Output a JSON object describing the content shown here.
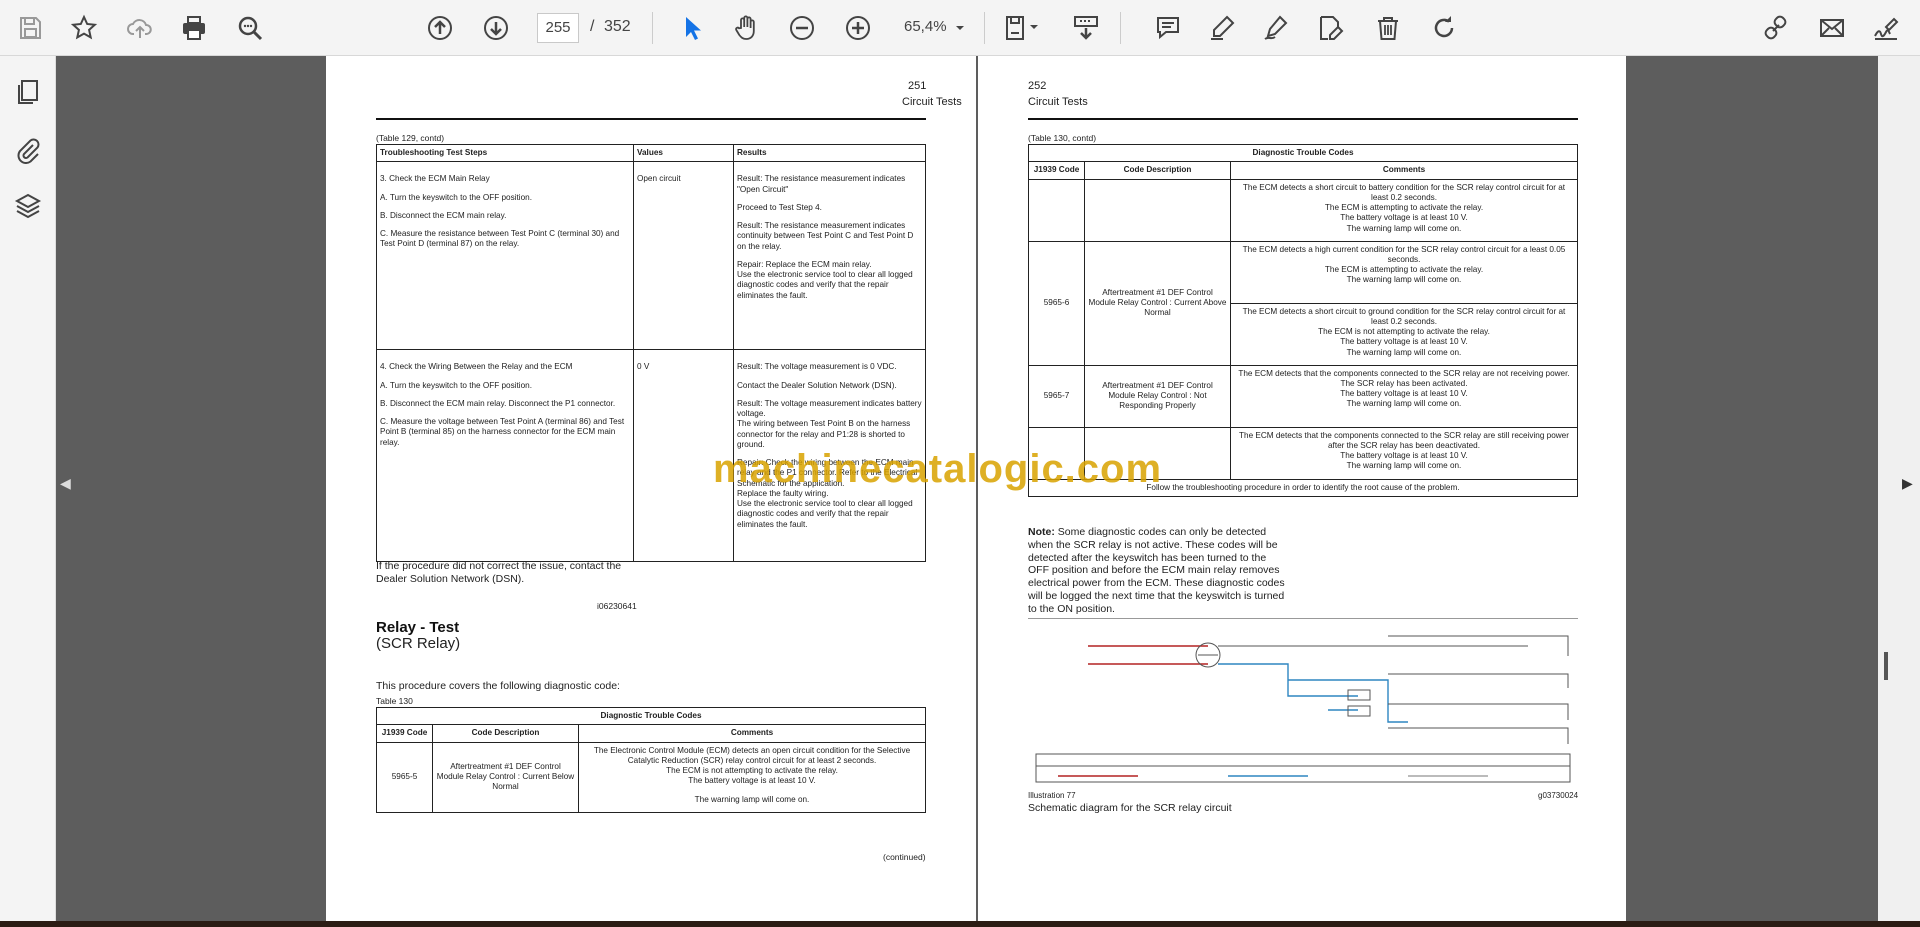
{
  "toolbar": {
    "page_current": "255",
    "page_separator": "/",
    "page_total": "352",
    "zoom": "65,4%"
  },
  "colors": {
    "accent": "#1473e6",
    "viewer_bg": "#5d5d5d",
    "watermark": "#d9a300"
  },
  "icons": [
    "save-icon",
    "star-icon",
    "cloud-upload-icon",
    "print-icon",
    "find-icon",
    "page-up-icon",
    "page-down-icon",
    "select-cursor-icon",
    "hand-icon",
    "zoom-out-icon",
    "zoom-in-icon",
    "chevron-down-icon",
    "fit-page-icon",
    "scroll-mode-icon",
    "comment-icon",
    "highlight-icon",
    "draw-icon",
    "edit-icon",
    "delete-icon",
    "rotate-icon",
    "share-icon",
    "mail-icon",
    "sign-icon",
    "pages-panel-icon",
    "attachment-icon",
    "layers-icon"
  ],
  "left_page": {
    "number": "251",
    "section": "Circuit Tests",
    "table_caption": "(Table 129, contd)",
    "headers": [
      "Troubleshooting Test Steps",
      "Values",
      "Results"
    ],
    "rows": [
      {
        "steps": [
          "3. Check the ECM Main Relay",
          "A. Turn the keyswitch to the OFF position.",
          "B. Disconnect the ECM main relay.",
          "C. Measure the resistance between Test Point C (terminal 30) and Test Point D (terminal 87) on the relay."
        ],
        "value": "Open circuit",
        "results": [
          "Result: The resistance measurement indicates \"Open Circuit\"",
          "Proceed to Test Step 4.",
          "Result: The resistance measurement indicates continuity between Test Point C and Test Point D on the relay.",
          "Repair: Replace the ECM main relay.\nUse the electronic service tool to clear all logged diagnostic codes and verify that the repair eliminates the fault."
        ]
      },
      {
        "steps": [
          "4. Check the Wiring Between the Relay and the ECM",
          "A. Turn the keyswitch to the OFF position.",
          "B. Disconnect the ECM main relay. Disconnect the P1 connector.",
          "C. Measure the voltage between Test Point A (terminal 86) and Test Point B (terminal 85) on the harness connector for the ECM main relay."
        ],
        "value": "0 V",
        "results": [
          "Result: The voltage measurement is 0 VDC.",
          "Contact the Dealer Solution Network (DSN).",
          "Result: The voltage measurement indicates battery voltage.\nThe wiring between Test Point B on the harness connector for the relay and P1:28 is shorted to ground.",
          "Repair: Check the wiring between the ECM main relay and the P1 connector. Refer to the Electrical Schematic for the application.\nReplace the faulty wiring.\nUse the electronic service tool to clear all logged diagnostic codes and verify that the repair eliminates the fault."
        ]
      }
    ],
    "after_text": "If the procedure did not correct the issue, contact the Dealer Solution Network (DSN).",
    "ref_id": "i06230641",
    "heading": "Relay - Test",
    "subheading": "(SCR Relay)",
    "intro": "This procedure covers the following diagnostic code:",
    "table130_label": "Table 130",
    "table130_title": "Diagnostic Trouble Codes",
    "table130_headers": [
      "J1939 Code",
      "Code Description",
      "Comments"
    ],
    "table130_row": {
      "code": "5965-5",
      "desc": "Aftertreatment #1 DEF Control Module Relay Control : Current Below Normal",
      "comments": [
        "The Electronic Control Module (ECM) detects an open circuit condition for the Selective Catalytic Reduction (SCR) relay control circuit for at least 2 seconds.\nThe ECM is not attempting to activate the relay.\nThe battery voltage is at least 10 V.",
        "The warning lamp will come on."
      ]
    },
    "continued": "(continued)"
  },
  "right_page": {
    "number": "252",
    "section": "Circuit Tests",
    "table_caption": "(Table 130, contd)",
    "title": "Diagnostic Trouble Codes",
    "headers": [
      "J1939 Code",
      "Code Description",
      "Comments"
    ],
    "rows": [
      {
        "code": "",
        "desc": "",
        "comment": "The ECM detects a short circuit to battery condition for the SCR relay control circuit for at least 0.2 seconds.\nThe ECM is attempting to activate the relay.\nThe battery voltage is at least 10 V.\nThe warning lamp will come on."
      },
      {
        "code": "5965-6",
        "desc": "Aftertreatment #1 DEF Control Module Relay Control : Current Above Normal",
        "comment": "The ECM detects a high current condition for the SCR relay control circuit for a least 0.05 seconds.\nThe ECM is attempting to activate the relay.\nThe warning lamp will come on."
      },
      {
        "code": "",
        "desc": "",
        "comment": "The ECM detects a short circuit to ground condition for the SCR relay control circuit for at least 0.2 seconds.\nThe ECM is not attempting to activate the relay.\nThe battery voltage is at least 10 V.\nThe warning lamp will come on."
      },
      {
        "code": "5965-7",
        "desc": "Aftertreatment #1 DEF Control Module Relay Control : Not Responding Properly",
        "comment": "The ECM detects that the components connected to the SCR relay are not receiving power.\nThe SCR relay has been activated.\nThe battery voltage is at least 10 V.\nThe warning lamp will come on."
      },
      {
        "code": "",
        "desc": "",
        "comment": "The ECM detects that the components connected to the SCR relay are still receiving power after the SCR relay has been deactivated.\nThe battery voltage is at least 10 V.\nThe warning lamp will come on."
      }
    ],
    "footer_row": "Follow the troubleshooting procedure in order to identify the root cause of the problem.",
    "note_label": "Note:",
    "note_text": " Some diagnostic codes can only be detected when the SCR relay is not active. These codes will be detected after the keyswitch has been turned to the OFF position and before the ECM main relay removes electrical power from the ECM. These diagnostic codes will be logged the next time that the keyswitch is turned to the ON position.",
    "illustration_label": "Illustration 77",
    "illustration_id": "g03730024",
    "illustration_caption": "Schematic diagram for the SCR relay circuit"
  },
  "watermark": "machinecatalogic.com"
}
